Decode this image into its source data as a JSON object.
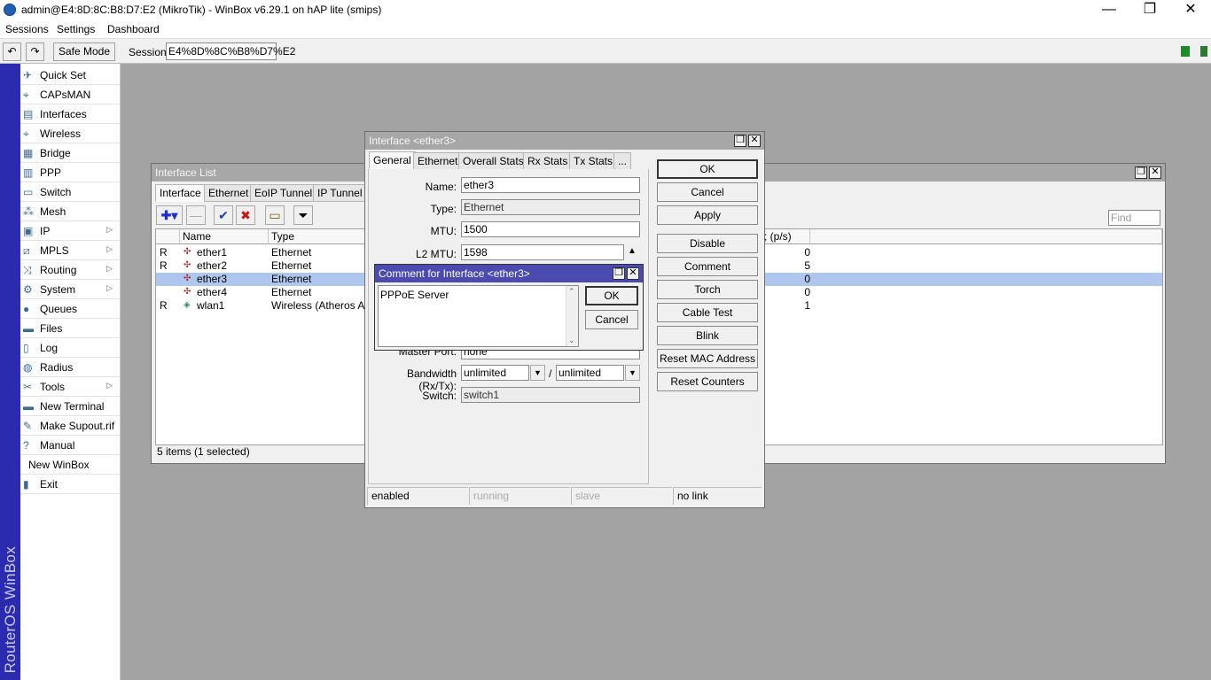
{
  "window": {
    "title": "admin@E4:8D:8C:B8:D7:E2 (MikroTik) - WinBox v6.29.1 on hAP lite (smips)",
    "minimize": "—",
    "maximize": "❐",
    "close": "✕"
  },
  "menu": [
    "Sessions",
    "Settings",
    "Dashboard"
  ],
  "toolbar": {
    "undo": "↶",
    "redo": "↷",
    "safe_mode": "Safe Mode",
    "session_label": "Session:",
    "session_value": "E4%8D%8C%B8%D7%E2",
    "status_colors": [
      "#1f8a2a",
      "#2b7a2b"
    ]
  },
  "brand": "RouterOS WinBox",
  "sidebar": {
    "items": [
      {
        "label": "Quick Set",
        "icon": "quick-set-icon",
        "arrow": ""
      },
      {
        "label": "CAPsMAN",
        "icon": "capsman-icon",
        "arrow": ""
      },
      {
        "label": "Interfaces",
        "icon": "interfaces-icon",
        "arrow": ""
      },
      {
        "label": "Wireless",
        "icon": "wireless-icon",
        "arrow": ""
      },
      {
        "label": "Bridge",
        "icon": "bridge-icon",
        "arrow": ""
      },
      {
        "label": "PPP",
        "icon": "ppp-icon",
        "arrow": ""
      },
      {
        "label": "Switch",
        "icon": "switch-icon",
        "arrow": ""
      },
      {
        "label": "Mesh",
        "icon": "mesh-icon",
        "arrow": ""
      },
      {
        "label": "IP",
        "icon": "ip-icon",
        "arrow": "▷"
      },
      {
        "label": "MPLS",
        "icon": "mpls-icon",
        "arrow": "▷"
      },
      {
        "label": "Routing",
        "icon": "routing-icon",
        "arrow": "▷"
      },
      {
        "label": "System",
        "icon": "system-gear-icon",
        "arrow": "▷"
      },
      {
        "label": "Queues",
        "icon": "queues-icon",
        "arrow": ""
      },
      {
        "label": "Files",
        "icon": "files-folder-icon",
        "arrow": ""
      },
      {
        "label": "Log",
        "icon": "log-icon",
        "arrow": ""
      },
      {
        "label": "Radius",
        "icon": "radius-icon",
        "arrow": ""
      },
      {
        "label": "Tools",
        "icon": "tools-icon",
        "arrow": "▷"
      },
      {
        "label": "New Terminal",
        "icon": "terminal-icon",
        "arrow": ""
      },
      {
        "label": "Make Supout.rif",
        "icon": "supout-icon",
        "arrow": ""
      },
      {
        "label": "Manual",
        "icon": "manual-help-icon",
        "arrow": ""
      },
      {
        "label": "New WinBox",
        "icon": "",
        "arrow": ""
      },
      {
        "label": "Exit",
        "icon": "exit-icon",
        "arrow": ""
      }
    ]
  },
  "interface_list": {
    "title": "Interface List",
    "tabs": [
      "Interface",
      "Ethernet",
      "EoIP Tunnel",
      "IP Tunnel"
    ],
    "tools": {
      "add": "✚▾",
      "remove": "—",
      "enable": "✔",
      "disable": "✖",
      "comment": "▭",
      "filter": "⏷"
    },
    "find_placeholder": "Find",
    "columns": {
      "flag": "",
      "name": "Name",
      "type": "Type",
      "rate": "; (p/s)"
    },
    "rows": [
      {
        "flag": "R",
        "name": "ether1",
        "type": "Ethernet",
        "rate": "0",
        "selected": false
      },
      {
        "flag": "R",
        "name": "ether2",
        "type": "Ethernet",
        "rate": "5",
        "selected": false
      },
      {
        "flag": "",
        "name": "ether3",
        "type": "Ethernet",
        "rate": "0",
        "selected": true
      },
      {
        "flag": "",
        "name": "ether4",
        "type": "Ethernet",
        "rate": "0",
        "selected": false
      },
      {
        "flag": "R",
        "name": "wlan1",
        "type": "Wireless (Atheros AR9",
        "rate": "1",
        "selected": false
      }
    ],
    "footer": "5 items (1 selected)"
  },
  "iface_dialog": {
    "title": "Interface <ether3>",
    "tabs": [
      "General",
      "Ethernet",
      "Overall Stats",
      "Rx Stats",
      "Tx Stats",
      "..."
    ],
    "fields": {
      "name_label": "Name:",
      "name_value": "ether3",
      "type_label": "Type:",
      "type_value": "Ethernet",
      "mtu_label": "MTU:",
      "mtu_value": "1500",
      "l2mtu_label": "L2 MTU:",
      "l2mtu_value": "1598",
      "master_label": "Master Port:",
      "master_value": "none",
      "bw_label": "Bandwidth (Rx/Tx):",
      "bw_rx": "unlimited",
      "bw_sep": "/",
      "bw_tx": "unlimited",
      "switch_label": "Switch:",
      "switch_value": "switch1"
    },
    "buttons": [
      "OK",
      "Cancel",
      "Apply",
      "Disable",
      "Comment",
      "Torch",
      "Cable Test",
      "Blink",
      "Reset MAC Address",
      "Reset Counters"
    ],
    "status": [
      "enabled",
      "running",
      "slave",
      "no link"
    ]
  },
  "comment_dialog": {
    "title": "Comment for Interface <ether3>",
    "text": "PPPoE Server",
    "ok": "OK",
    "cancel": "Cancel"
  }
}
